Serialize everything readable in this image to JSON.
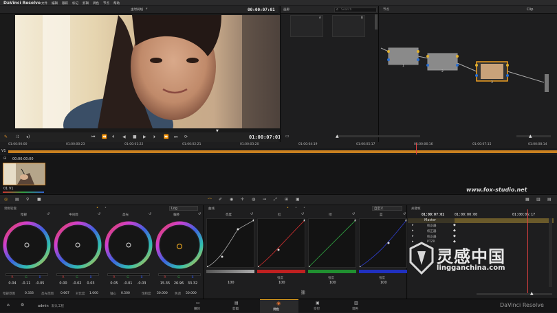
{
  "menubar": {
    "app": "DaVinci Resolve",
    "items": [
      "文件",
      "编辑",
      "跟踪",
      "标记",
      "剪辑",
      "调色",
      "节点",
      "帮助"
    ]
  },
  "viewer": {
    "mode": "主时间线",
    "timecode": "00:00:07:01",
    "bottom_timecode": "01:00:07:01"
  },
  "gallery": {
    "title": "画廊",
    "search_placeholder": "Search",
    "thumbs": [
      "A",
      "B"
    ]
  },
  "nodes": {
    "title": "节点",
    "mode": "Clip",
    "items": [
      "1",
      "2",
      "3"
    ]
  },
  "timeline": {
    "ticks": [
      "01:00:00:00",
      "01:00:00:23",
      "01:00:01:22",
      "01:00:02:21",
      "01:00:03:20",
      "01:00:04:19",
      "01:00:05:17",
      "01:00:06:16",
      "01:00:07:15",
      "01:00:08:14"
    ],
    "track": "V1"
  },
  "clip": {
    "timecode": "00:00:00:00",
    "label": "01  V1"
  },
  "watermark": "www.fox-studio.net",
  "colorwheels": {
    "title": "调色轮盘",
    "mode": "Log",
    "wheels": [
      {
        "name": "暗部",
        "r": "0.04",
        "g": "-0.11",
        "b": "-0.05"
      },
      {
        "name": "中间调",
        "r": "0.00",
        "g": "-0.02",
        "b": "0.03"
      },
      {
        "name": "高光",
        "r": "0.05",
        "g": "-0.01",
        "b": "-0.03"
      },
      {
        "name": "偏移",
        "r": "15.35",
        "g": "26.96",
        "b": "33.32"
      }
    ],
    "rgb_labels": [
      "R",
      "G",
      "B"
    ],
    "footer": [
      {
        "k": "暗部范围",
        "v": "0.333"
      },
      {
        "k": "高光范围",
        "v": "0.667"
      },
      {
        "k": "对比度",
        "v": "1.000"
      },
      {
        "k": "轴心",
        "v": "0.500"
      },
      {
        "k": "饱和度",
        "v": "50.000"
      },
      {
        "k": "色调",
        "v": "50.000"
      }
    ]
  },
  "curves": {
    "title": "曲线",
    "mode": "自定义",
    "panels": [
      {
        "name": "亮度",
        "label": "",
        "value": "100",
        "color": "#aaaaaa"
      },
      {
        "name": "红",
        "label": "强度",
        "value": "100",
        "color": "#d03030"
      },
      {
        "name": "绿",
        "label": "强度",
        "value": "100",
        "color": "#30a040"
      },
      {
        "name": "蓝",
        "label": "强度",
        "value": "100",
        "color": "#3040d0"
      }
    ]
  },
  "keyframes": {
    "title": "关键帧",
    "tc1": "01:00:07:01",
    "tc2": "01:00:00:00",
    "tc3": "01:00:05:17",
    "rows": [
      "Master",
      "校正器",
      "校正器",
      "校正器",
      "PTZR"
    ]
  },
  "tabs": [
    "媒体",
    "剪辑",
    "调色",
    "交付",
    "调色"
  ],
  "active_tab": "调色",
  "user": "admin",
  "project": "默认工程",
  "brand": "DaVinci Resolve",
  "logo_text": {
    "cn": "灵感中国",
    "en": "lingganchina.com"
  }
}
